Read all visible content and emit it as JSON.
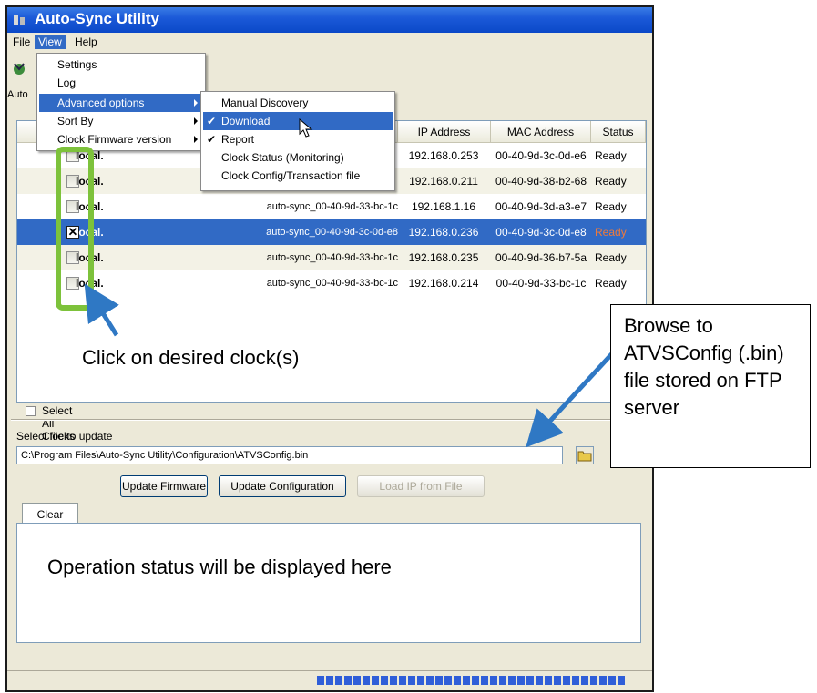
{
  "window": {
    "title": "Auto-Sync Utility"
  },
  "menubar": {
    "file": "File",
    "view": "View",
    "help": "Help"
  },
  "toolbar": {
    "label": "Auto"
  },
  "view_menu": {
    "items": [
      {
        "label": "Settings"
      },
      {
        "label": "Log"
      },
      {
        "label": "Advanced options"
      },
      {
        "label": "Sort By"
      },
      {
        "label": "Clock Firmware version"
      }
    ]
  },
  "advanced_menu": {
    "items": [
      {
        "label": "Manual Discovery",
        "checked": false
      },
      {
        "label": "Download",
        "checked": true
      },
      {
        "label": "Report",
        "checked": true
      },
      {
        "label": "Clock Status (Monitoring)",
        "checked": false
      },
      {
        "label": "Clock Config/Transaction file",
        "checked": false
      }
    ]
  },
  "table": {
    "headers": {
      "ip": "IP Address",
      "mac": "MAC Address",
      "status": "Status"
    },
    "rows": [
      {
        "name": "local.",
        "host": "",
        "ip": "192.168.0.253",
        "mac": "00-40-9d-3c-0d-e6",
        "status": "Ready",
        "checked": false
      },
      {
        "name": "local.",
        "host": "",
        "ip": "192.168.0.211",
        "mac": "00-40-9d-38-b2-68",
        "status": "Ready",
        "checked": false
      },
      {
        "name": "local.",
        "host": "auto-sync_00-40-9d-33-bc-1c",
        "ip": "192.168.1.16",
        "mac": "00-40-9d-3d-a3-e7",
        "status": "Ready",
        "checked": false
      },
      {
        "name": "local.",
        "host": "auto-sync_00-40-9d-3c-0d-e8",
        "ip": "192.168.0.236",
        "mac": "00-40-9d-3c-0d-e8",
        "status": "Ready",
        "checked": true
      },
      {
        "name": "local.",
        "host": "auto-sync_00-40-9d-33-bc-1c",
        "ip": "192.168.0.235",
        "mac": "00-40-9d-36-b7-5a",
        "status": "Ready",
        "checked": false
      },
      {
        "name": "local.",
        "host": "auto-sync_00-40-9d-33-bc-1c",
        "ip": "192.168.0.214",
        "mac": "00-40-9d-33-bc-1c",
        "status": "Ready",
        "checked": false
      }
    ]
  },
  "select_all": {
    "label": "Select All Clocks"
  },
  "file_section": {
    "label": "Select file to update",
    "path": "C:\\Program Files\\Auto-Sync Utility\\Configuration\\ATVSConfig.bin"
  },
  "buttons": {
    "update_firmware": "Update Firmware",
    "update_configuration": "Update Configuration",
    "load_ip": "Load IP from File",
    "clear": "Clear"
  },
  "annotations": {
    "click_clocks": "Click on desired clock(s)",
    "browse": "Browse to ATVSConfig (.bin) file stored on FTP server",
    "status": "Operation status will be displayed here"
  },
  "colors": {
    "accent": "#316ac5",
    "annotation_green": "#7dc23b",
    "arrow_blue": "#2f78c4"
  }
}
